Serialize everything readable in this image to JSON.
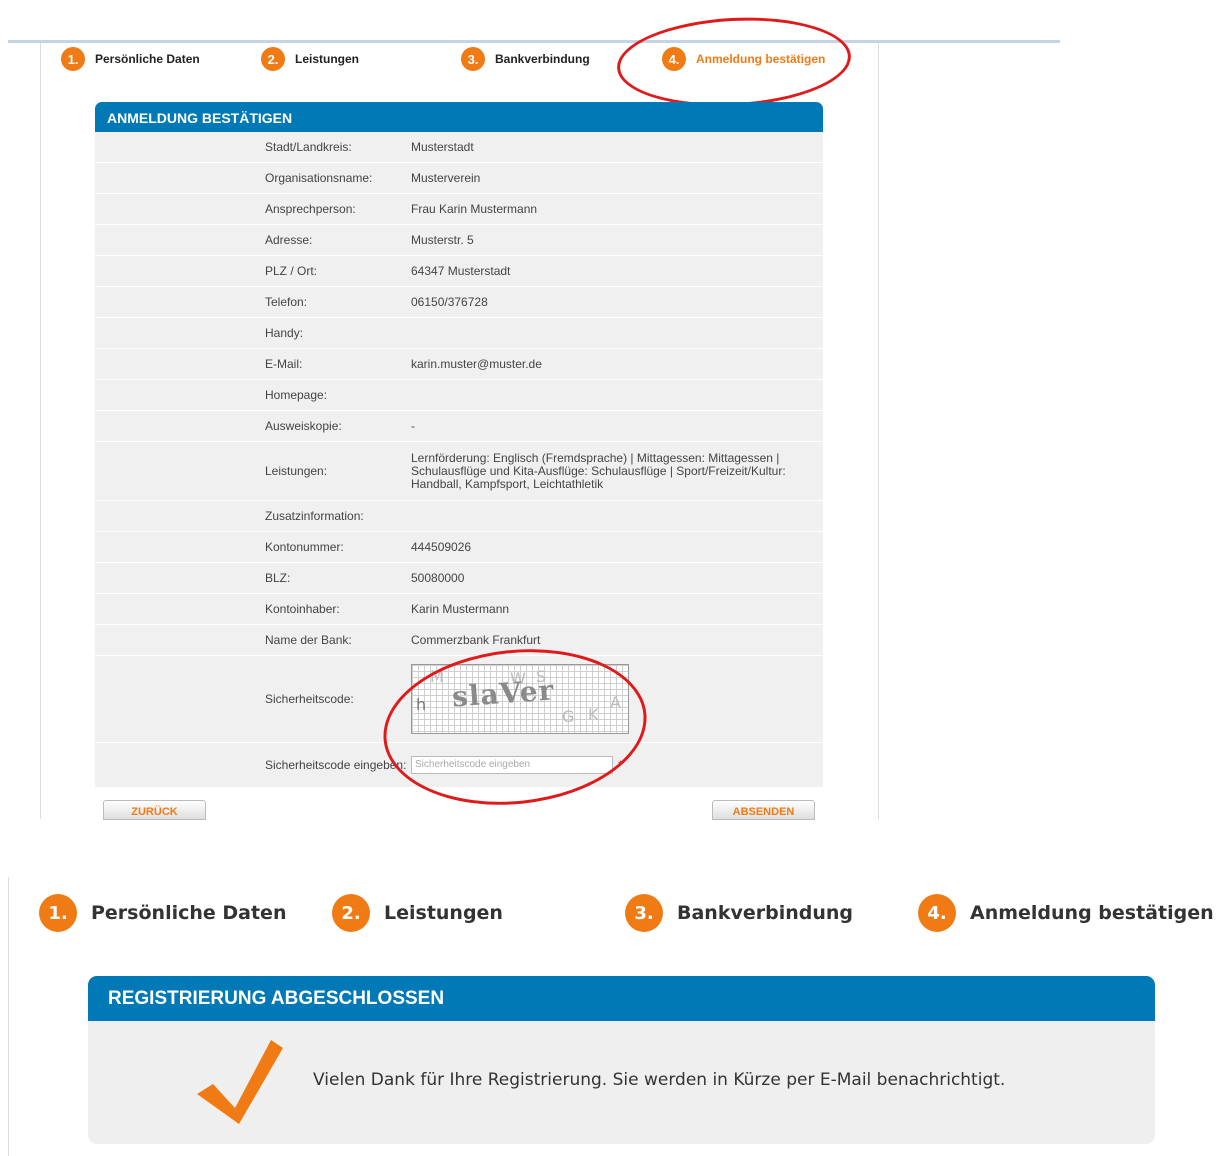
{
  "confirm_screen": {
    "steps": [
      {
        "num": "1.",
        "label": "Persönliche Daten"
      },
      {
        "num": "2.",
        "label": "Leistungen"
      },
      {
        "num": "3.",
        "label": "Bankverbindung"
      },
      {
        "num": "4.",
        "label": "Anmeldung bestätigen"
      }
    ],
    "panel_title": "ANMELDUNG BESTÄTIGEN",
    "rows": [
      {
        "label": "Stadt/Landkreis:",
        "value": "Musterstadt"
      },
      {
        "label": "Organisationsname:",
        "value": "Musterverein"
      },
      {
        "label": "Ansprechperson:",
        "value": "Frau Karin Mustermann"
      },
      {
        "label": "Adresse:",
        "value": "Musterstr. 5"
      },
      {
        "label": "PLZ / Ort:",
        "value": "64347 Musterstadt"
      },
      {
        "label": "Telefon:",
        "value": "06150/376728"
      },
      {
        "label": "Handy:",
        "value": ""
      },
      {
        "label": "E-Mail:",
        "value": "karin.muster@muster.de"
      },
      {
        "label": "Homepage:",
        "value": ""
      },
      {
        "label": "Ausweiskopie:",
        "value": "-"
      },
      {
        "label": "Leistungen:",
        "value": "Lernförderung: Englisch (Fremdsprache) | Mittagessen: Mittagessen | Schulausflüge und Kita-Ausflüge: Schulausflüge | Sport/Freizeit/Kultur: Handball, Kampfsport, Leichtathletik"
      },
      {
        "label": "Zusatzinformation:",
        "value": ""
      },
      {
        "label": "Kontonummer:",
        "value": "444509026"
      },
      {
        "label": "BLZ:",
        "value": "50080000"
      },
      {
        "label": "Kontoinhaber:",
        "value": "Karin Mustermann"
      },
      {
        "label": "Name der Bank:",
        "value": "Commerzbank Frankfurt"
      }
    ],
    "captcha_label": "Sicherheitscode:",
    "captcha_text": "slaVer",
    "code_label": "Sicherheitscode eingeben:",
    "code_placeholder": "Sicherheitscode eingeben",
    "required_mark": "*",
    "back_button": "ZURÜCK",
    "submit_button": "ABSENDEN"
  },
  "done_screen": {
    "steps": [
      {
        "num": "1.",
        "label": "Persönliche Daten"
      },
      {
        "num": "2.",
        "label": "Leistungen"
      },
      {
        "num": "3.",
        "label": "Bankverbindung"
      },
      {
        "num": "4.",
        "label": "Anmeldung bestätigen"
      }
    ],
    "panel_title": "REGISTRIERUNG ABGESCHLOSSEN",
    "message": "Vielen Dank für Ihre Registrierung. Sie werden in Kürze per E-Mail benachrichtigt."
  },
  "colors": {
    "accent": "#f07b14",
    "header_blue": "#0079b6",
    "highlight_ring": "#e01a1a",
    "row_bg": "#f0f0f0"
  },
  "icons": [
    "checkmark-icon"
  ]
}
